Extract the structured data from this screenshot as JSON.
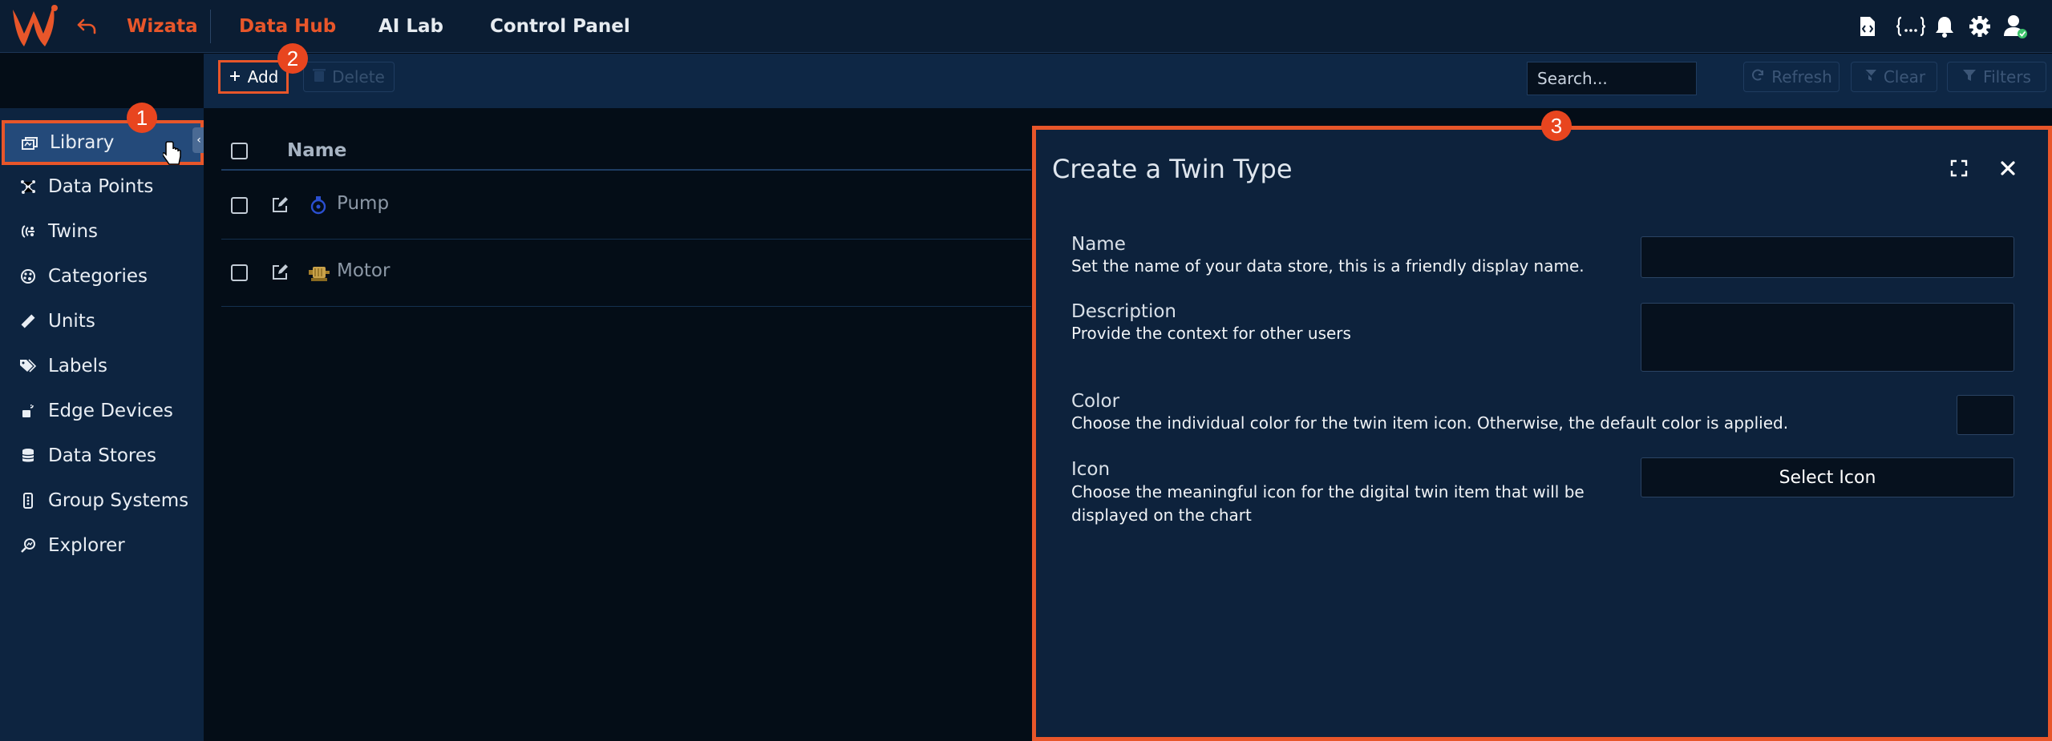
{
  "colors": {
    "accent": "#e8562a",
    "nav_bg": "#0b1d33",
    "sidebar_bg": "#0d2440",
    "dialog_bg": "#0d223c"
  },
  "nav": {
    "brand": "Wizata",
    "tabs": [
      {
        "label": "Data Hub",
        "active": true
      },
      {
        "label": "AI Lab",
        "active": false
      },
      {
        "label": "Control Panel",
        "active": false
      }
    ],
    "icons": [
      "code-file-icon",
      "json-braces-icon",
      "bell-icon",
      "gear-icon",
      "user-icon"
    ]
  },
  "toolbar": {
    "add_label": "Add",
    "delete_label": "Delete",
    "search_placeholder": "Search...",
    "refresh_label": "Refresh",
    "clear_label": "Clear",
    "filters_label": "Filters"
  },
  "sidebar": {
    "items": [
      {
        "label": "Library",
        "icon": "library-icon",
        "active": true
      },
      {
        "label": "Data Points",
        "icon": "data-points-icon"
      },
      {
        "label": "Twins",
        "icon": "twins-icon"
      },
      {
        "label": "Categories",
        "icon": "categories-icon"
      },
      {
        "label": "Units",
        "icon": "ruler-icon"
      },
      {
        "label": "Labels",
        "icon": "tag-icon"
      },
      {
        "label": "Edge Devices",
        "icon": "edge-device-icon"
      },
      {
        "label": "Data Stores",
        "icon": "database-icon"
      },
      {
        "label": "Group Systems",
        "icon": "group-systems-icon"
      },
      {
        "label": "Explorer",
        "icon": "explorer-icon"
      }
    ]
  },
  "table": {
    "header": {
      "name": "Name"
    },
    "rows": [
      {
        "name": "Pump",
        "icon": "pump-icon"
      },
      {
        "name": "Motor",
        "icon": "motor-icon"
      }
    ]
  },
  "dialog": {
    "title": "Create a Twin Type",
    "fields": {
      "name": {
        "label": "Name",
        "description": "Set the name of your data store, this is a friendly display name.",
        "value": ""
      },
      "description": {
        "label": "Description",
        "description": "Provide the context for other users",
        "value": ""
      },
      "color": {
        "label": "Color",
        "description": "Choose the individual color for the twin item icon. Otherwise, the default color is applied."
      },
      "icon": {
        "label": "Icon",
        "description": "Choose the meaningful icon for the digital twin item that will be displayed on the chart",
        "button_label": "Select Icon"
      }
    }
  },
  "badges": {
    "one": "1",
    "two": "2",
    "three": "3"
  }
}
